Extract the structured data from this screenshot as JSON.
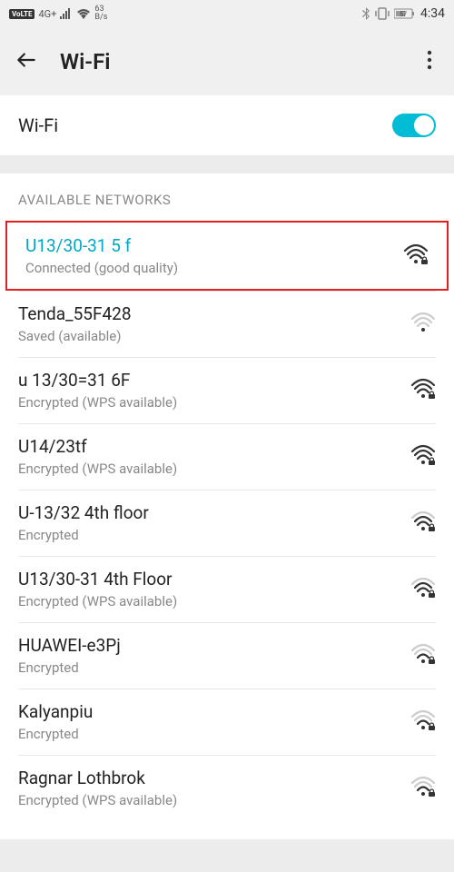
{
  "status_bar": {
    "volte": "VoLTE",
    "signal": "4G+",
    "speed_top": "63",
    "speed_bottom": "B/s",
    "time": "4:34",
    "battery": "57"
  },
  "header": {
    "title": "Wi-Fi"
  },
  "toggle": {
    "label": "Wi-Fi",
    "on": true
  },
  "section_title": "AVAILABLE NETWORKS",
  "networks": [
    {
      "name": "U13/30-31 5 f",
      "status": "Connected (good quality)",
      "connected": true,
      "strength": 4,
      "locked": true,
      "highlight": true
    },
    {
      "name": "Tenda_55F428",
      "status": "Saved (available)",
      "connected": false,
      "strength": 1,
      "locked": false,
      "highlight": false
    },
    {
      "name": "u 13/30=31 6F",
      "status": "Encrypted (WPS available)",
      "connected": false,
      "strength": 4,
      "locked": true,
      "highlight": false
    },
    {
      "name": "U14/23tf",
      "status": "Encrypted (WPS available)",
      "connected": false,
      "strength": 4,
      "locked": true,
      "highlight": false
    },
    {
      "name": "U-13/32 4th floor",
      "status": "Encrypted",
      "connected": false,
      "strength": 3,
      "locked": true,
      "highlight": false
    },
    {
      "name": "U13/30-31 4th Floor",
      "status": "Encrypted (WPS available)",
      "connected": false,
      "strength": 3,
      "locked": true,
      "highlight": false
    },
    {
      "name": "HUAWEI-e3Pj",
      "status": "Encrypted",
      "connected": false,
      "strength": 2,
      "locked": true,
      "highlight": false
    },
    {
      "name": "Kalyanpiu",
      "status": "Encrypted",
      "connected": false,
      "strength": 2,
      "locked": true,
      "highlight": false
    },
    {
      "name": "Ragnar Lothbrok",
      "status": "Encrypted (WPS available)",
      "connected": false,
      "strength": 2,
      "locked": true,
      "highlight": false
    }
  ]
}
